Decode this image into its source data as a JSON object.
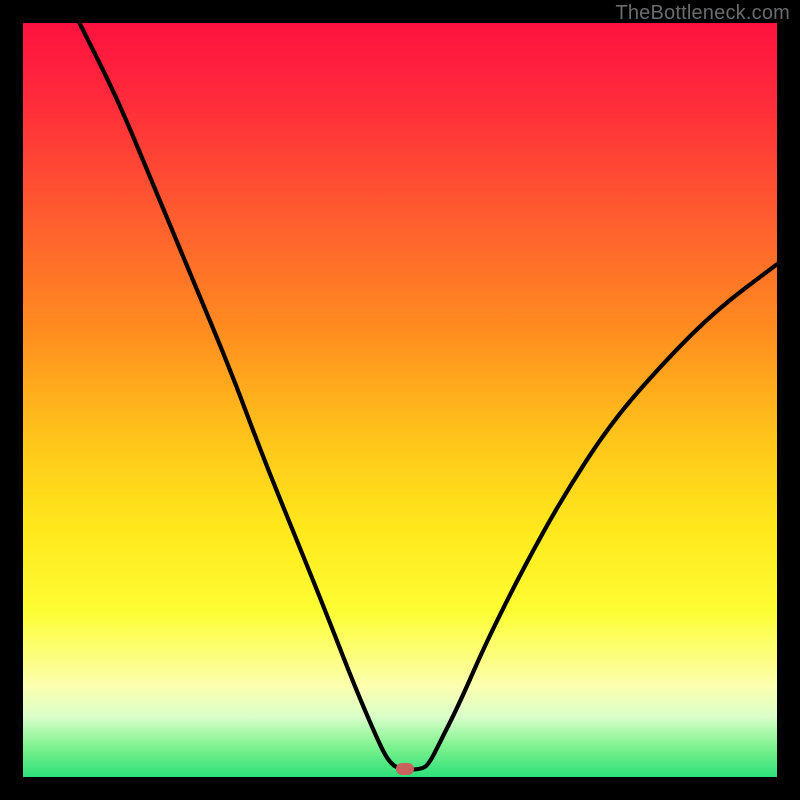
{
  "watermark": "TheBottleneck.com",
  "marker": {
    "x_frac": 0.507,
    "y_frac": 0.99,
    "color": "#c9615c"
  },
  "chart_data": {
    "type": "line",
    "title": "",
    "xlabel": "",
    "ylabel": "",
    "xlim": [
      0,
      1
    ],
    "ylim": [
      0,
      100
    ],
    "series": [
      {
        "name": "curve",
        "x": [
          0.075,
          0.125,
          0.175,
          0.225,
          0.275,
          0.32,
          0.365,
          0.405,
          0.44,
          0.47,
          0.485,
          0.5,
          0.53,
          0.54,
          0.555,
          0.58,
          0.615,
          0.66,
          0.715,
          0.78,
          0.85,
          0.92,
          1.0
        ],
        "y": [
          100,
          90,
          78,
          66,
          54,
          42,
          31,
          21,
          12,
          5,
          2,
          1,
          1,
          2,
          5,
          10,
          18,
          27,
          37,
          47,
          55,
          62,
          68
        ]
      }
    ],
    "marker_point": {
      "x": 0.515,
      "y": 1
    }
  }
}
